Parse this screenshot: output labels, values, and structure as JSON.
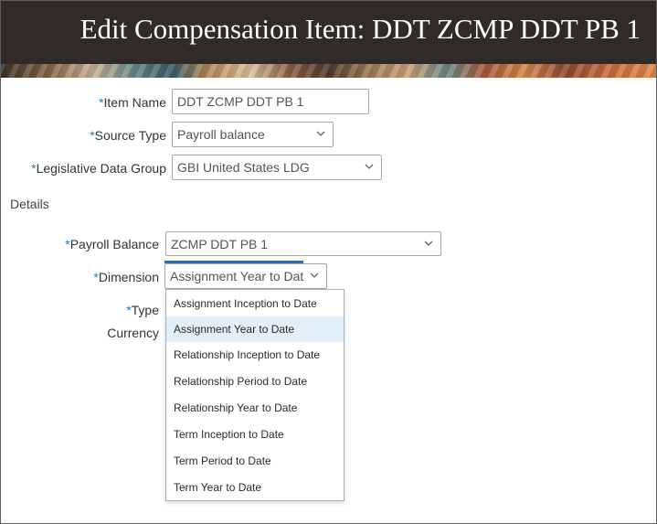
{
  "header": {
    "title": "Edit Compensation Item: DDT ZCMP DDT PB 1"
  },
  "form": {
    "required_marker": "*",
    "item_name": {
      "label": "Item Name",
      "value": "DDT ZCMP DDT PB 1"
    },
    "source_type": {
      "label": "Source Type",
      "value": "Payroll balance"
    },
    "legislative_data_group": {
      "label": "Legislative Data Group",
      "value": "GBI United States LDG"
    }
  },
  "details": {
    "heading": "Details",
    "payroll_balance": {
      "label": "Payroll Balance",
      "value": "ZCMP DDT PB 1"
    },
    "dimension": {
      "label": "Dimension",
      "value": "Assignment Year to Dat"
    },
    "type": {
      "label": "Type"
    },
    "currency": {
      "label": "Currency"
    }
  },
  "dimension_options": [
    "Assignment Inception to Date",
    "Assignment Year to Date",
    "Relationship Inception to Date",
    "Relationship Period to Date",
    "Relationship Year to Date",
    "Term Inception to Date",
    "Term Period to Date",
    "Term Year to Date"
  ],
  "selected_option_index": 1,
  "icons": {
    "dropdown": "chevron-down-icon"
  },
  "colors": {
    "required": "#1a7fc1",
    "header_bg": "#302b28",
    "focus": "#1a73c8",
    "selected_option_bg": "#e3eef8"
  }
}
